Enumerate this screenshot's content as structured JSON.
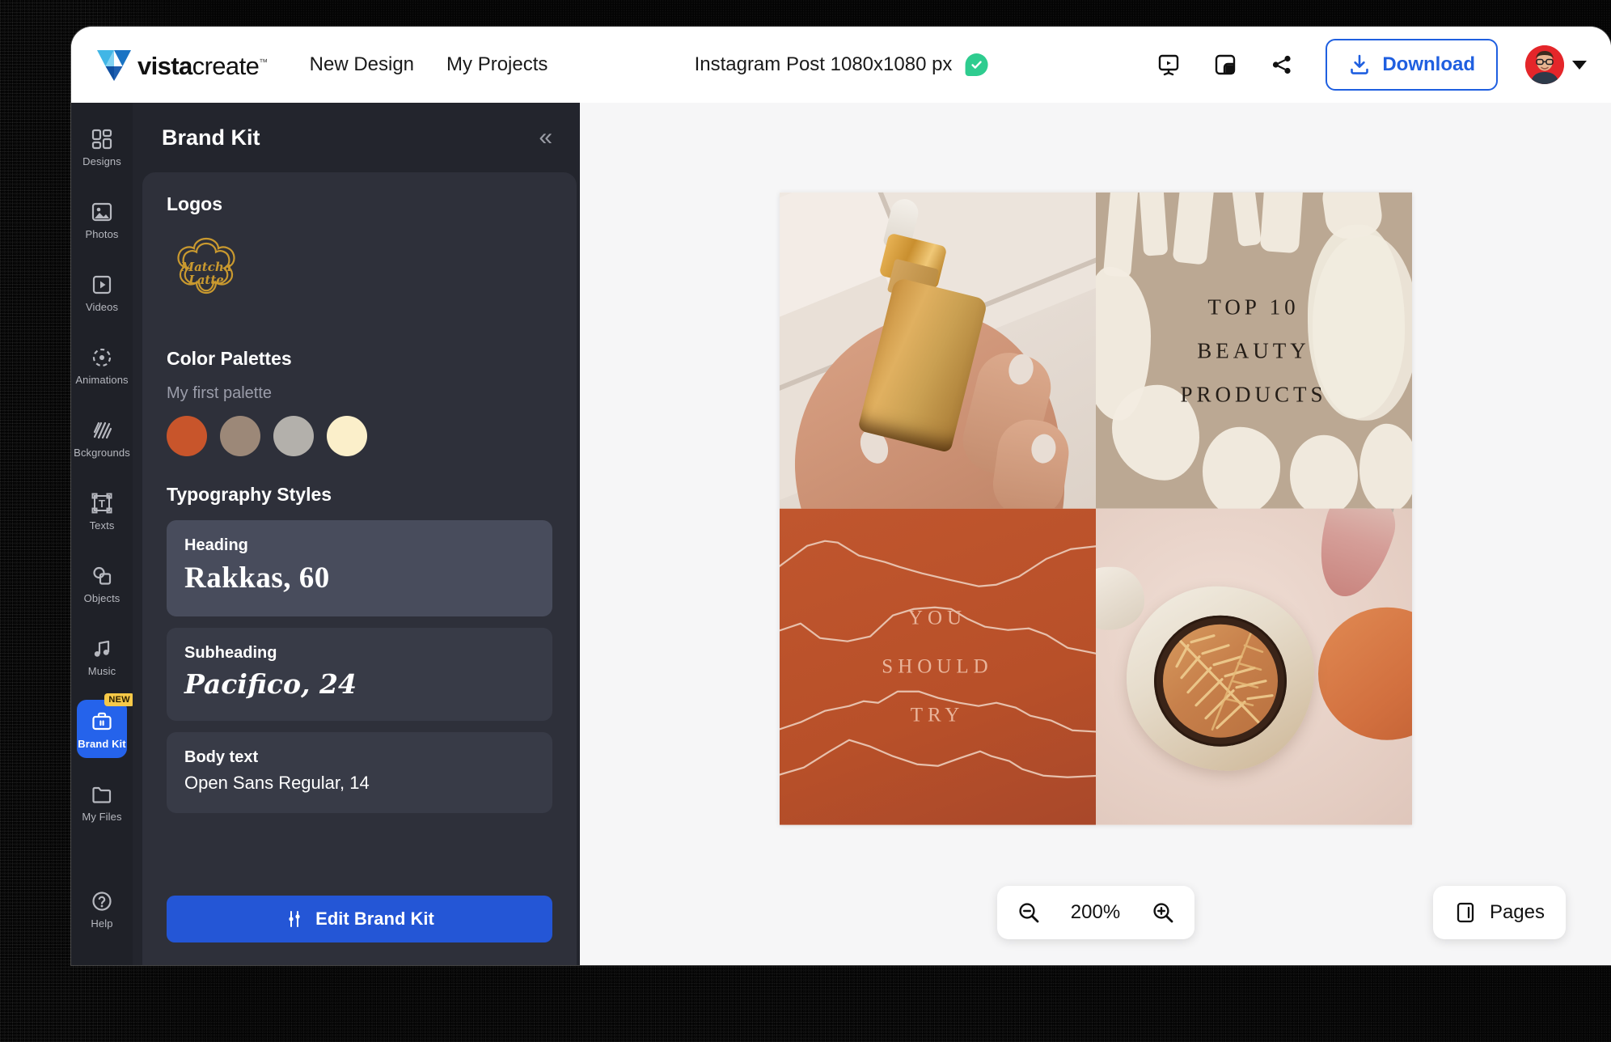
{
  "app": {
    "brand_bold": "vista",
    "brand_light": "create",
    "trademark": "™"
  },
  "topbar": {
    "nav": [
      {
        "label": "New Design"
      },
      {
        "label": "My Projects"
      }
    ],
    "document_title": "Instagram Post 1080x1080 px",
    "saved_icon": "check-circle-icon",
    "present_icon": "present-icon",
    "resize_icon": "resize-icon",
    "share_icon": "share-icon",
    "download_label": "Download",
    "download_icon": "download-icon",
    "avatar_alt": "user-avatar",
    "account_caret": "chevron-down-icon",
    "accent_blue": "#1f5fe0"
  },
  "rail": {
    "items": [
      {
        "label": "Designs",
        "icon": "grid-icon",
        "active": false,
        "badge": ""
      },
      {
        "label": "Photos",
        "icon": "image-icon",
        "active": false,
        "badge": ""
      },
      {
        "label": "Videos",
        "icon": "video-icon",
        "active": false,
        "badge": ""
      },
      {
        "label": "Animations",
        "icon": "animation-icon",
        "active": false,
        "badge": ""
      },
      {
        "label": "Bckgrounds",
        "icon": "hatch-icon",
        "active": false,
        "badge": ""
      },
      {
        "label": "Texts",
        "icon": "text-box-icon",
        "active": false,
        "badge": ""
      },
      {
        "label": "Objects",
        "icon": "shapes-icon",
        "active": false,
        "badge": ""
      },
      {
        "label": "Music",
        "icon": "music-note-icon",
        "active": false,
        "badge": ""
      },
      {
        "label": "Brand Kit",
        "icon": "briefcase-icon",
        "active": true,
        "badge": "NEW"
      },
      {
        "label": "My Files",
        "icon": "folder-icon",
        "active": false,
        "badge": ""
      }
    ],
    "help": {
      "label": "Help",
      "icon": "question-circle-icon"
    },
    "active_color": "#2563eb",
    "badge_color": "#f7c948"
  },
  "panel": {
    "title": "Brand Kit",
    "collapse_icon": "chevron-double-left-icon",
    "logos": {
      "heading": "Logos",
      "logo_name_line1": "Matcha",
      "logo_name_line2": "Latte",
      "logo_color": "#c9992f"
    },
    "palettes": {
      "heading": "Color Palettes",
      "palette_name": "My first palette",
      "colors": [
        "#c8552b",
        "#9c8878",
        "#b3b0ab",
        "#fbefca"
      ]
    },
    "typography": {
      "heading": "Typography Styles",
      "styles": [
        {
          "label": "Heading",
          "sample": "Rakkas, 60",
          "selected": true
        },
        {
          "label": "Subheading",
          "sample": "Pacifico, 24",
          "selected": false
        },
        {
          "label": "Body text",
          "sample": "Open Sans Regular, 14",
          "selected": false
        }
      ]
    },
    "edit_button": {
      "label": "Edit Brand Kit",
      "icon": "sliders-icon",
      "color": "#2456d6"
    }
  },
  "canvas": {
    "quadrants": [
      {
        "name": "serum-bottle-photo",
        "kind": "photo",
        "text": ""
      },
      {
        "name": "top-10-beauty-products-card",
        "kind": "text",
        "lines": [
          "TOP 10",
          "BEAUTY",
          "PRODUCTS"
        ],
        "bg": "#bba893",
        "text_color": "#241d17"
      },
      {
        "name": "you-should-try-card",
        "kind": "text",
        "lines": [
          "YOU",
          "SHOULD",
          "TRY"
        ],
        "bg": "#b85029",
        "text_color": "#e9b49a"
      },
      {
        "name": "makeup-flatlay-photo",
        "kind": "photo",
        "text": ""
      }
    ]
  },
  "footer": {
    "zoom_out_icon": "zoom-out-icon",
    "zoom_value": "200%",
    "zoom_in_icon": "zoom-in-icon",
    "pages_label": "Pages",
    "pages_icon": "pages-panel-icon"
  }
}
